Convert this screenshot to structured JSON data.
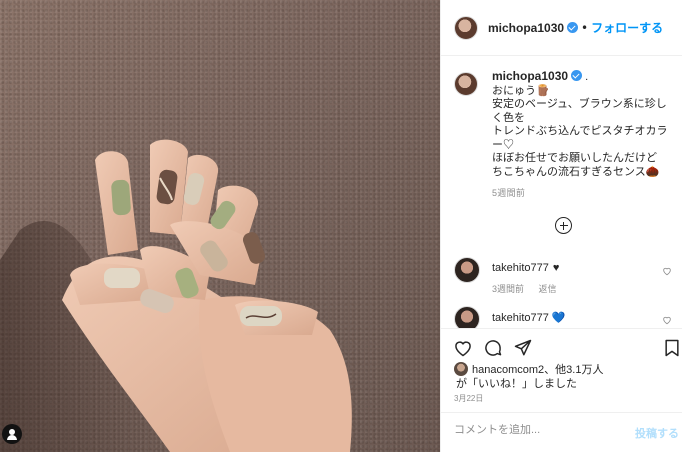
{
  "post": {
    "username": "michopa1030",
    "follow_label": "フォローする",
    "separator": "•",
    "caption_username": "michopa1030",
    "caption_text": "おにゅう🪵\n安定のベージュ、ブラウン系に珍しく色を\nトレンドぶち込んでピスタチオカラー♡\nほぼお任せでお願いしたんだけど\nちこちゃんの流石すぎるセンス🌰",
    "caption_time": "5週間前",
    "caption_trailing": "."
  },
  "comments": [
    {
      "username": "takehito777",
      "text": "♥",
      "time": "3週間前",
      "reply_label": "返信"
    },
    {
      "username": "takehito777",
      "text": "💙"
    }
  ],
  "likes": {
    "line1": "hanacomcom2、他3.1万人",
    "line2": "が「いいね！」しました"
  },
  "date": "3月22日",
  "comment_box": {
    "placeholder": "コメントを追加...",
    "post_label": "投稿する"
  },
  "icons": {
    "like": "heart-icon",
    "comment": "comment-icon",
    "share": "share-icon",
    "save": "bookmark-icon",
    "more": "plus-circle-icon"
  },
  "colors": {
    "accent": "#0095f6",
    "verified": "#3897f0",
    "muted": "#8e8e8e"
  }
}
